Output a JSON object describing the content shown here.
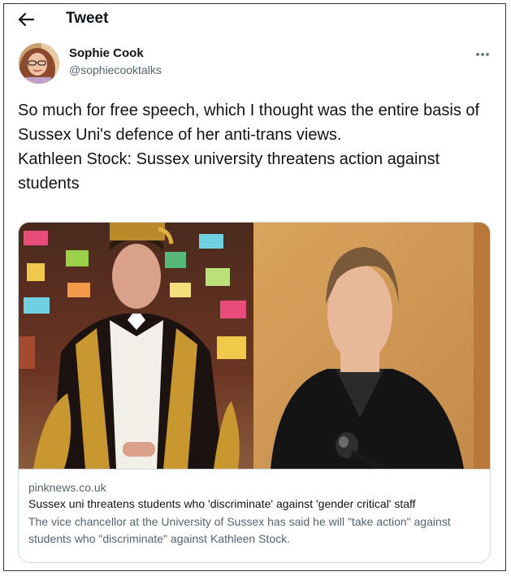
{
  "header": {
    "title": "Tweet",
    "back_icon": "arrow-left-icon"
  },
  "tweet": {
    "author": {
      "name": "Sophie Cook",
      "handle": "@sophiecooktalks"
    },
    "more_icon": "ellipsis-icon",
    "text": "So much for free speech, which I thought was the entire basis of Sussex Uni's defence of her anti-trans views.\nKathleen Stock: Sussex university threatens action against students"
  },
  "card": {
    "domain": "pinknews.co.uk",
    "title": "Sussex uni threatens students who 'discriminate' against 'gender critical' staff",
    "description": "The vice chancellor at the University of Sussex has said he will \"take action\" against students who \"discriminate\" against Kathleen Stock."
  },
  "colors": {
    "text_primary": "#0f1419",
    "text_secondary": "#536471",
    "card_border": "#cfd9de"
  }
}
